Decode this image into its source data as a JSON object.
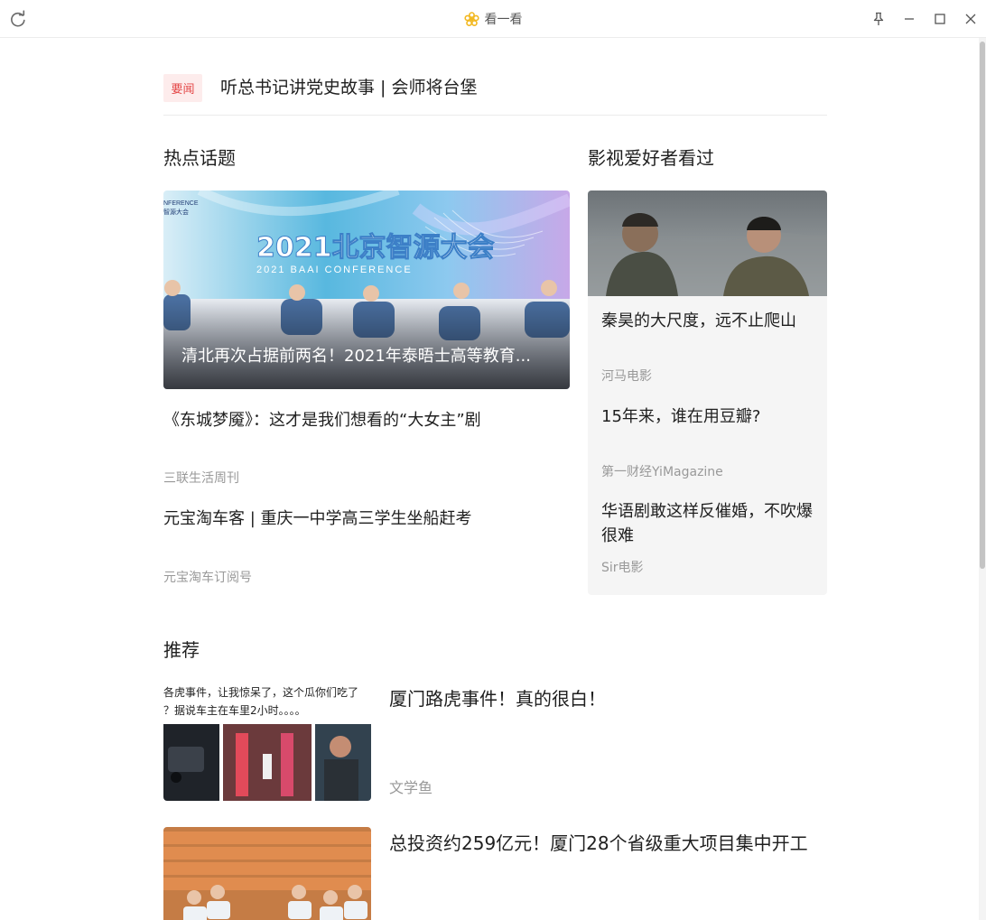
{
  "titlebar": {
    "title": "看一看",
    "refresh_icon": "refresh-icon",
    "logo_icon": "flower-logo-icon",
    "pin_icon": "pin-icon",
    "minimize_icon": "minimize-icon",
    "maximize_icon": "maximize-icon",
    "close_icon": "close-icon"
  },
  "headline": {
    "tag": "要闻",
    "title": "听总书记讲党史故事 | 会师将台堡"
  },
  "hot_topics": {
    "heading": "热点话题",
    "hero": {
      "image_text": "2021北京智源大会",
      "image_subtext": "2021 BAAI CONFERENCE",
      "image_corner_text_1": "NFERENCE",
      "image_corner_text_2": "智源大会",
      "caption": "清北再次占据前两名！2021年泰晤士高等教育..."
    },
    "articles": [
      {
        "title": "《东城梦魇》：这才是我们想看的“大女主”剧",
        "source": "三联生活周刊"
      },
      {
        "title": "元宝淘车客 | 重庆一中学高三学生坐船赶考",
        "source": "元宝淘车订阅号"
      }
    ]
  },
  "film_fans": {
    "heading": "影视爱好者看过",
    "articles": [
      {
        "title": "秦昊的大尺度，远不止爬山",
        "source": "河马电影"
      },
      {
        "title": "15年来，谁在用豆瓣?",
        "source": "第一财经YiMagazine"
      },
      {
        "title": "华语剧敢这样反催婚，不吹爆很难",
        "source": "Sir电影"
      }
    ]
  },
  "recommend": {
    "heading": "推荐",
    "items": [
      {
        "title": "厦门路虎事件！真的很白！",
        "source": "文学鱼",
        "thumb_text_1": "各虎事件，让我惊呆了，这个瓜你们吃了",
        "thumb_text_2": "？据说车主在车里2小时。。。。"
      },
      {
        "title": "总投资约259亿元！厦门28个省级重大项目集中开工",
        "source": ""
      }
    ]
  },
  "colors": {
    "tag_bg": "#fdecec",
    "tag_text": "#e44848",
    "source_text": "#999999",
    "card_bg": "#f5f5f5",
    "logo": "#f2b821"
  }
}
